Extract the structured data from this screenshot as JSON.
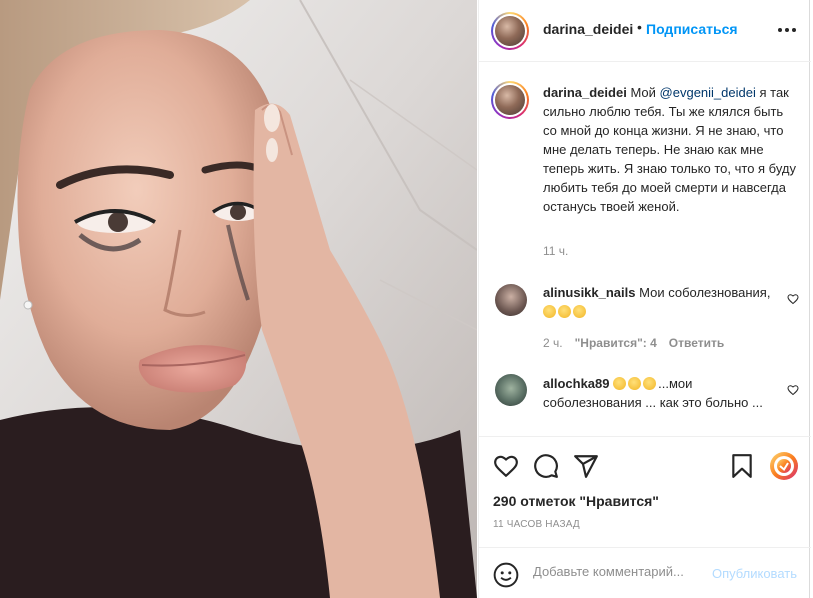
{
  "post": {
    "username": "darina_deidei",
    "separator": "•",
    "follow_label": "Подписаться",
    "caption": {
      "username": "darina_deidei",
      "text_before": "Мой",
      "mention": "@evgenii_deidei",
      "text_after": "я так сильно люблю тебя. Ты же клялся быть со мной до конца жизни. Я не знаю, что мне делать теперь. Не знаю как мне теперь жить. Я знаю только то, что я буду любить тебя до моей смерти и навсегда останусь твоей женой.",
      "time": "11 ч."
    },
    "comments": [
      {
        "username": "alinusikk_nails",
        "text": "Мои соболезнования,",
        "emojis": [
          "crying-face",
          "sad-face",
          "pensive-face"
        ],
        "time": "2 ч.",
        "likes": "\"Нравится\": 4",
        "reply_label": "Ответить"
      },
      {
        "username": "allochka89",
        "emojis": [
          "sad-face",
          "sad-face",
          "sad-face"
        ],
        "text": "...мои соболезнования ... как это больно ..."
      }
    ],
    "likes_label": "290 отметок \"Нравится\"",
    "time_ago": "11 ЧАСОВ НАЗАД",
    "add_comment": {
      "placeholder": "Добавьте комментарий...",
      "post_label": "Опубликовать"
    }
  },
  "colors": {
    "link": "#0095f6",
    "mention": "#00376b",
    "muted": "#8e8e8e",
    "text": "#262626",
    "post_disabled": "#b3dbff"
  },
  "icons": [
    "more-icon",
    "heart-icon",
    "comment-icon",
    "share-icon",
    "bookmark-icon",
    "sticker-icon",
    "emoji-icon"
  ]
}
